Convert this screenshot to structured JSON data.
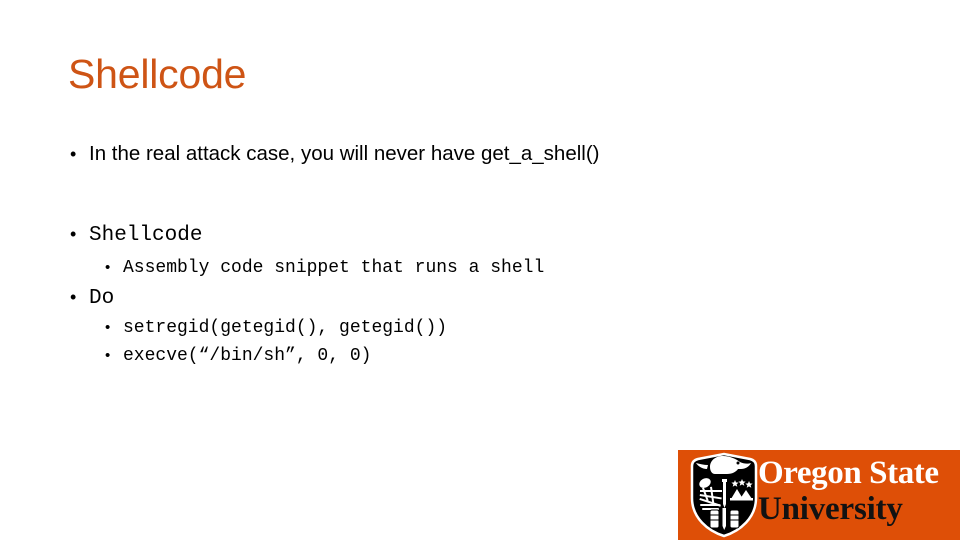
{
  "slide": {
    "title": "Shellcode",
    "title_color": "#CE5415",
    "background_color": "#FFFFFF",
    "body_text_color": "#000000"
  },
  "content": {
    "bullets": [
      {
        "level": 1,
        "style": "sans",
        "marker": "•",
        "text": "In the real attack case, you will never have get_a_shell()"
      },
      {
        "level": 1,
        "style": "mono",
        "marker": "•",
        "text": "Shellcode"
      },
      {
        "level": 2,
        "style": "mono",
        "marker": "•",
        "text": "Assembly code snippet that runs a shell"
      },
      {
        "level": 1,
        "style": "mono",
        "marker": "•",
        "text": "Do"
      },
      {
        "level": 2,
        "style": "mono",
        "marker": "•",
        "text": "setregid(getegid(), getegid())"
      },
      {
        "level": 2,
        "style": "mono",
        "marker": "•",
        "text": "execve(“/bin/sh”, 0, 0)"
      }
    ]
  },
  "logo": {
    "name": "oregon-state-university-logo",
    "block_color": "#DE4F07",
    "emblem": "osu-beaver-shield-icon",
    "line1": "Oregon State",
    "line1_color": "#FFFFFF",
    "line2": "University",
    "line2_color": "#121212"
  }
}
